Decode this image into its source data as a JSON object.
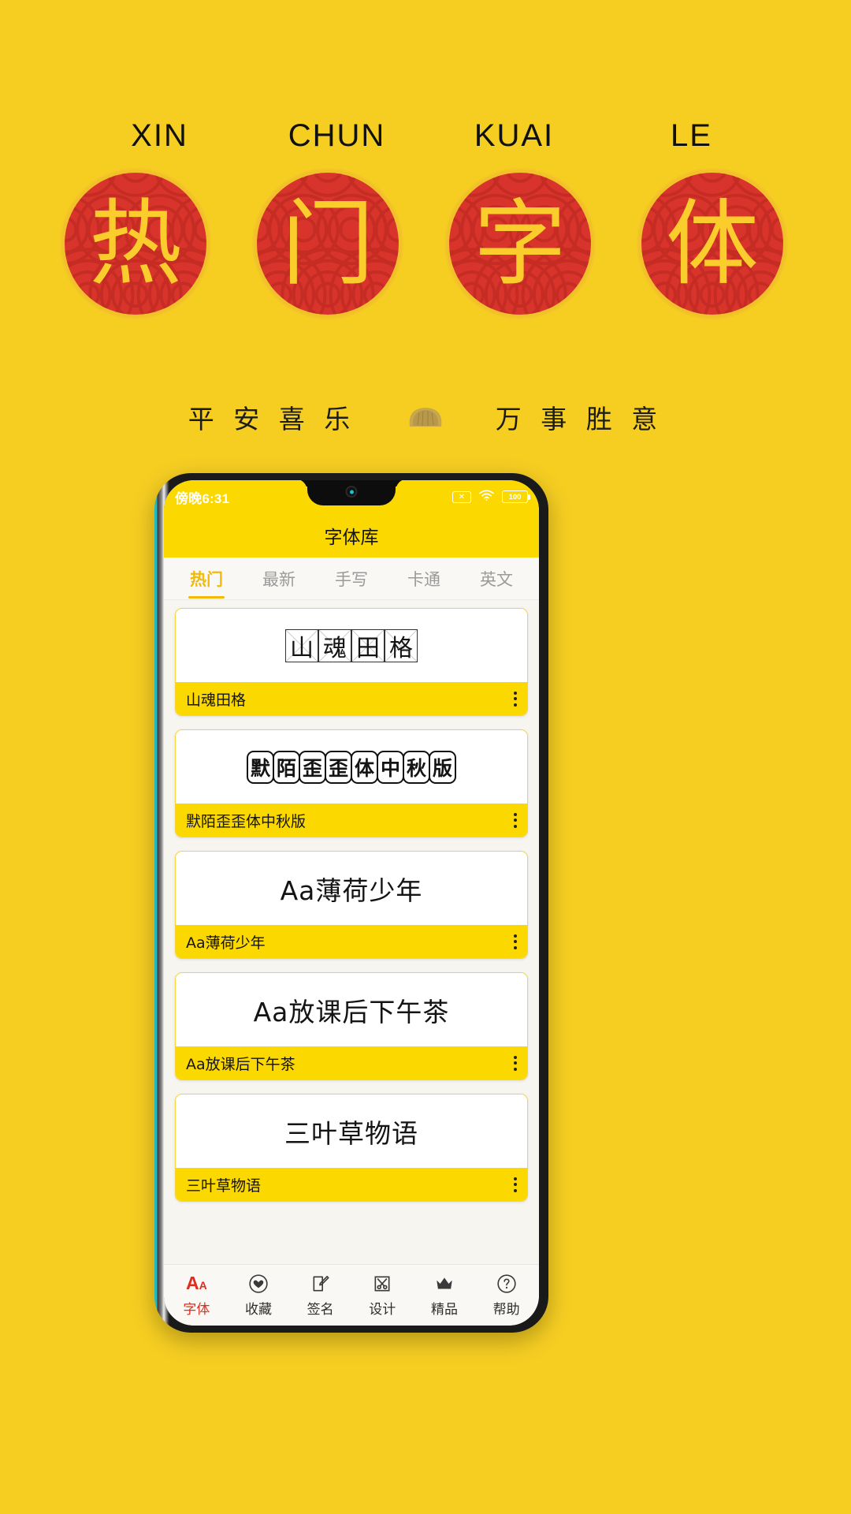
{
  "poster": {
    "background_color": "#F6CE22",
    "pinyin": [
      "XIN",
      "CHUN",
      "KUAI",
      "LE"
    ],
    "circle_glyphs": [
      "热",
      "门",
      "字",
      "体"
    ],
    "circle_bg_color": "#D9342B",
    "circle_border_color": "#F2C12A",
    "glyph_color": "#FACD2C",
    "blessing_left": "平 安 喜 乐",
    "blessing_right": "万 事 胜 意",
    "ornament": "gold-ingot"
  },
  "phone": {
    "statusbar": {
      "time": "傍晚6:31",
      "icons": [
        "x-box-icon",
        "wifi-icon",
        "battery-icon"
      ],
      "battery_level": "100"
    },
    "appbar": {
      "title": "字体库"
    },
    "tabs": [
      {
        "label": "热门",
        "active": true
      },
      {
        "label": "最新",
        "active": false
      },
      {
        "label": "手写",
        "active": false
      },
      {
        "label": "卡通",
        "active": false
      },
      {
        "label": "英文",
        "active": false
      }
    ],
    "accent_color": "#FBD800",
    "active_tab_color": "#F3B90A",
    "fonts": [
      {
        "sample": "山魂田格",
        "name": "山魂田格",
        "style": "grid"
      },
      {
        "sample": "默陌歪歪体中秋版",
        "name": "默陌歪歪体中秋版",
        "style": "bubble"
      },
      {
        "sample": "Aa薄荷少年",
        "name": "Aa薄荷少年",
        "style": "hand"
      },
      {
        "sample": "Aa放课后下午茶",
        "name": "Aa放课后下午茶",
        "style": "hand"
      },
      {
        "sample": "三叶草物语",
        "name": "三叶草物语",
        "style": "hand"
      }
    ],
    "menu_icon": "more-vertical-icon",
    "bottomnav": [
      {
        "label": "字体",
        "icon": "font-aa-icon",
        "active": true
      },
      {
        "label": "收藏",
        "icon": "heart-icon",
        "active": false
      },
      {
        "label": "签名",
        "icon": "pen-edit-icon",
        "active": false
      },
      {
        "label": "设计",
        "icon": "scissors-icon",
        "active": false
      },
      {
        "label": "精品",
        "icon": "crown-icon",
        "active": false
      },
      {
        "label": "帮助",
        "icon": "question-circle-icon",
        "active": false
      }
    ],
    "active_nav_color": "#E02B1E"
  }
}
